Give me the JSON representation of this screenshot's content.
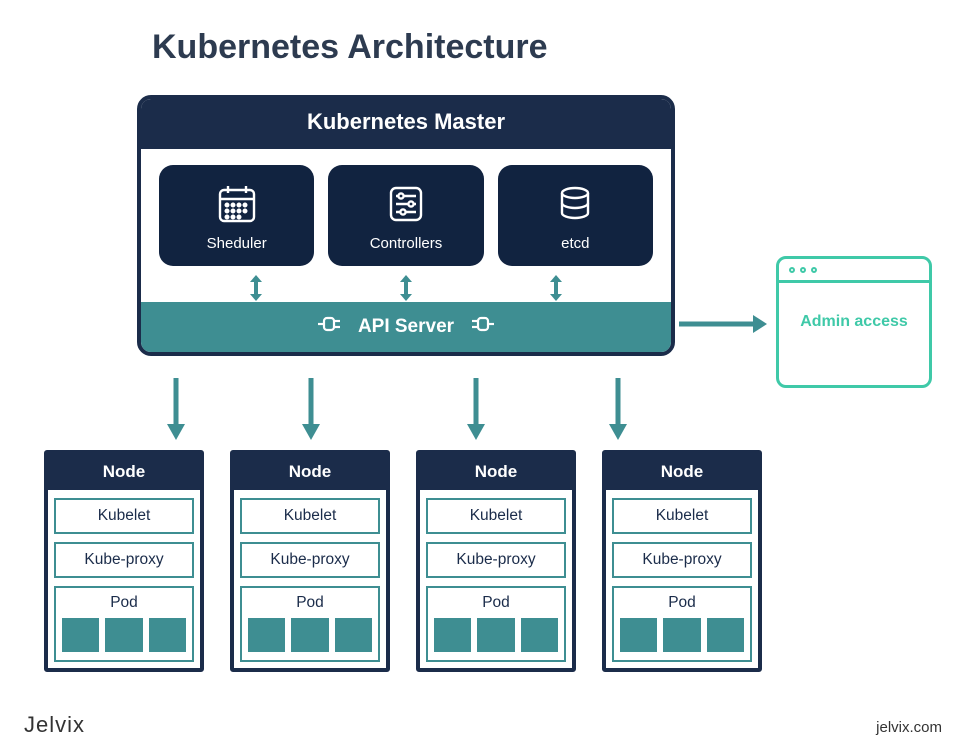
{
  "title": "Kubernetes Architecture",
  "master": {
    "header": "Kubernetes Master",
    "components": {
      "scheduler": "Sheduler",
      "controllers": "Controllers",
      "etcd": "etcd"
    },
    "api_server": "API Server"
  },
  "admin": {
    "label": "Admin access"
  },
  "nodes": [
    {
      "header": "Node",
      "kubelet": "Kubelet",
      "kube_proxy": "Kube-proxy",
      "pod": "Pod"
    },
    {
      "header": "Node",
      "kubelet": "Kubelet",
      "kube_proxy": "Kube-proxy",
      "pod": "Pod"
    },
    {
      "header": "Node",
      "kubelet": "Kubelet",
      "kube_proxy": "Kube-proxy",
      "pod": "Pod"
    },
    {
      "header": "Node",
      "kubelet": "Kubelet",
      "kube_proxy": "Kube-proxy",
      "pod": "Pod"
    }
  ],
  "footer": {
    "brand": "Jelvix",
    "url": "jelvix.com"
  },
  "colors": {
    "dark": "#1b2c4a",
    "darker": "#112340",
    "teal": "#3e8e92",
    "mint": "#3fc9a8"
  }
}
